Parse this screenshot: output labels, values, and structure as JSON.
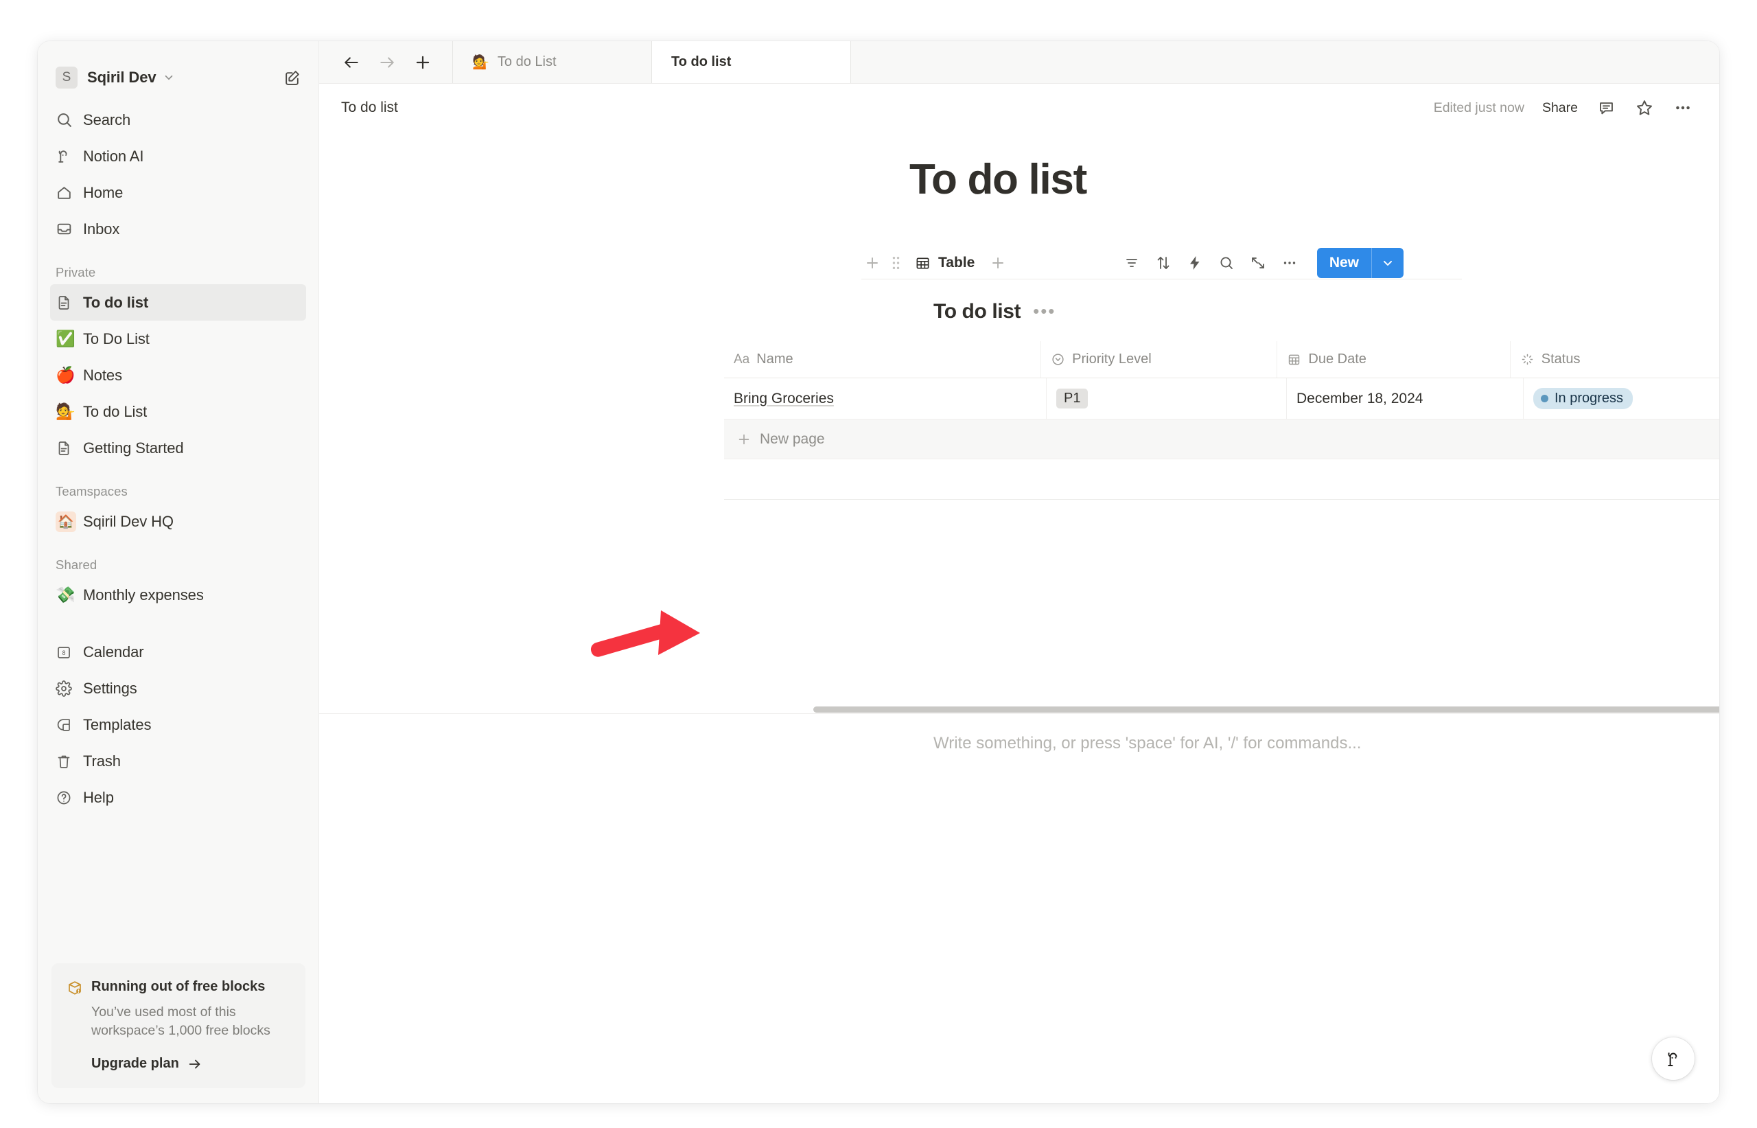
{
  "sidebar": {
    "workspace": {
      "initial": "S",
      "name": "Sqiril Dev",
      "chevron_icon": "chevron-down-icon",
      "edit_icon": "compose-icon"
    },
    "nav": [
      {
        "label": "Search",
        "icon": "search-icon"
      },
      {
        "label": "Notion AI",
        "icon": "notion-ai-icon"
      },
      {
        "label": "Home",
        "icon": "home-icon"
      },
      {
        "label": "Inbox",
        "icon": "inbox-icon"
      }
    ],
    "private_header": "Private",
    "private_items": [
      {
        "label": "To do list",
        "icon": "page-icon",
        "emoji": "",
        "active": true
      },
      {
        "label": "To Do List",
        "icon": "emoji",
        "emoji": "✅",
        "active": false
      },
      {
        "label": "Notes",
        "icon": "emoji",
        "emoji": "🍎",
        "active": false
      },
      {
        "label": "To do List",
        "icon": "emoji",
        "emoji": "💁",
        "active": false
      },
      {
        "label": "Getting Started",
        "icon": "page-icon",
        "emoji": "",
        "active": false
      }
    ],
    "teamspaces_header": "Teamspaces",
    "teamspaces": [
      {
        "label": "Sqiril Dev HQ",
        "emoji": "🏠"
      }
    ],
    "shared_header": "Shared",
    "shared": [
      {
        "label": "Monthly expenses",
        "emoji": "💸"
      }
    ],
    "bottom_nav": [
      {
        "label": "Calendar",
        "icon": "calendar-icon",
        "badge": "8"
      },
      {
        "label": "Settings",
        "icon": "gear-icon"
      },
      {
        "label": "Templates",
        "icon": "templates-icon"
      },
      {
        "label": "Trash",
        "icon": "trash-icon"
      },
      {
        "label": "Help",
        "icon": "help-icon"
      }
    ],
    "upgrade": {
      "icon": "box-alert-icon",
      "title": "Running out of free blocks",
      "body": "You’ve used most of this workspace’s 1,000 free blocks",
      "link": "Upgrade plan",
      "link_arrow": "arrow-right-icon"
    }
  },
  "tabbar": {
    "back_icon": "arrow-left-icon",
    "forward_icon": "arrow-right-icon",
    "new_tab_icon": "plus-icon",
    "tabs": [
      {
        "label": "To do List",
        "emoji": "💁",
        "active": false
      },
      {
        "label": "To do list",
        "emoji": "",
        "active": true
      }
    ]
  },
  "header": {
    "breadcrumb": "To do list",
    "edited": "Edited just now",
    "share": "Share",
    "comment_icon": "comment-icon",
    "favorite_icon": "star-icon",
    "more_icon": "ellipsis-icon"
  },
  "page": {
    "title": "To do list",
    "placeholder": "Write something, or press 'space' for AI, '/' for commands...",
    "ai_fab_icon": "notion-ai-icon"
  },
  "database": {
    "view_name": "Table",
    "view_icon": "table-icon",
    "add_view_icon": "plus-icon",
    "drag_handle_icon": "grip-icon",
    "block_add_icon": "plus-icon",
    "title": "To do list",
    "title_more_icon": "ellipsis-icon",
    "toolbar_icons": [
      {
        "name": "filter-icon"
      },
      {
        "name": "sort-icon"
      },
      {
        "name": "automation-icon"
      },
      {
        "name": "search-icon"
      },
      {
        "name": "expand-icon"
      },
      {
        "name": "ellipsis-icon"
      }
    ],
    "new_button": {
      "label": "New",
      "chevron_icon": "chevron-down-icon",
      "color": "#2f8ae8"
    },
    "columns": [
      {
        "label": "Name",
        "type_icon": "text-aa-icon"
      },
      {
        "label": "Priority Level",
        "type_icon": "select-icon"
      },
      {
        "label": "Due Date",
        "type_icon": "calendar-icon"
      },
      {
        "label": "Status",
        "type_icon": "status-icon"
      }
    ],
    "header_actions": [
      {
        "name": "add-column-icon",
        "glyph": "+"
      },
      {
        "name": "column-options-icon",
        "glyph": "•••"
      }
    ],
    "rows": [
      {
        "name": "Bring Groceries",
        "priority": "P1",
        "due_date": "December 18, 2024",
        "status": "In progress",
        "status_color": "#d3e5ef",
        "status_dot": "#5b97bd"
      }
    ],
    "new_row_label": "New page",
    "new_row_icon": "plus-icon"
  }
}
